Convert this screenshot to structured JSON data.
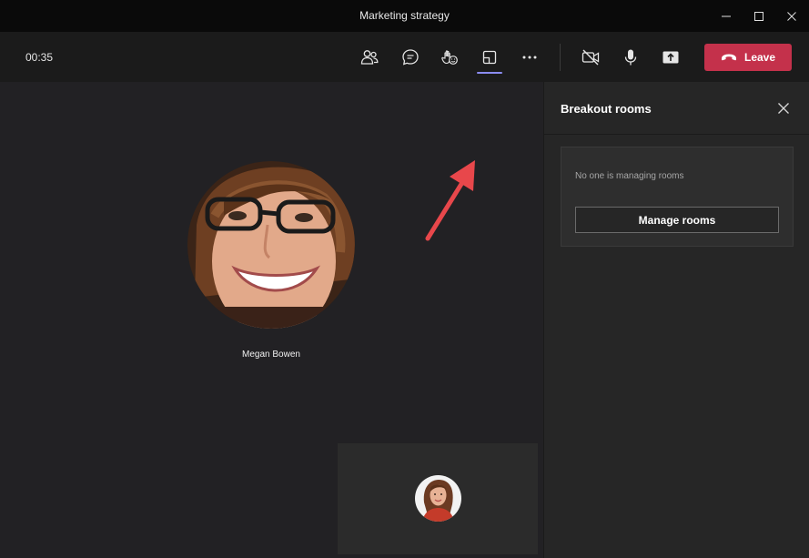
{
  "window": {
    "title": "Marketing strategy"
  },
  "toolbar": {
    "timer": "00:35",
    "leave_label": "Leave",
    "buttons": [
      {
        "name": "participants",
        "icon": "people-icon"
      },
      {
        "name": "chat",
        "icon": "chat-icon"
      },
      {
        "name": "reactions",
        "icon": "reactions-icon"
      },
      {
        "name": "breakout-rooms",
        "icon": "breakout-rooms-icon",
        "active": true
      },
      {
        "name": "more-actions",
        "icon": "more-icon"
      },
      {
        "name": "camera",
        "icon": "camera-off-icon"
      },
      {
        "name": "mic",
        "icon": "mic-icon"
      },
      {
        "name": "share",
        "icon": "share-icon"
      }
    ],
    "leave_color": "#c4314b",
    "active_underline_color": "#8b8cf0"
  },
  "stage": {
    "participant_name": "Megan Bowen"
  },
  "panel": {
    "title": "Breakout rooms",
    "status_text": "No one is managing rooms",
    "manage_button_label": "Manage rooms"
  },
  "annotation": {
    "arrow_color": "#e8474b"
  }
}
